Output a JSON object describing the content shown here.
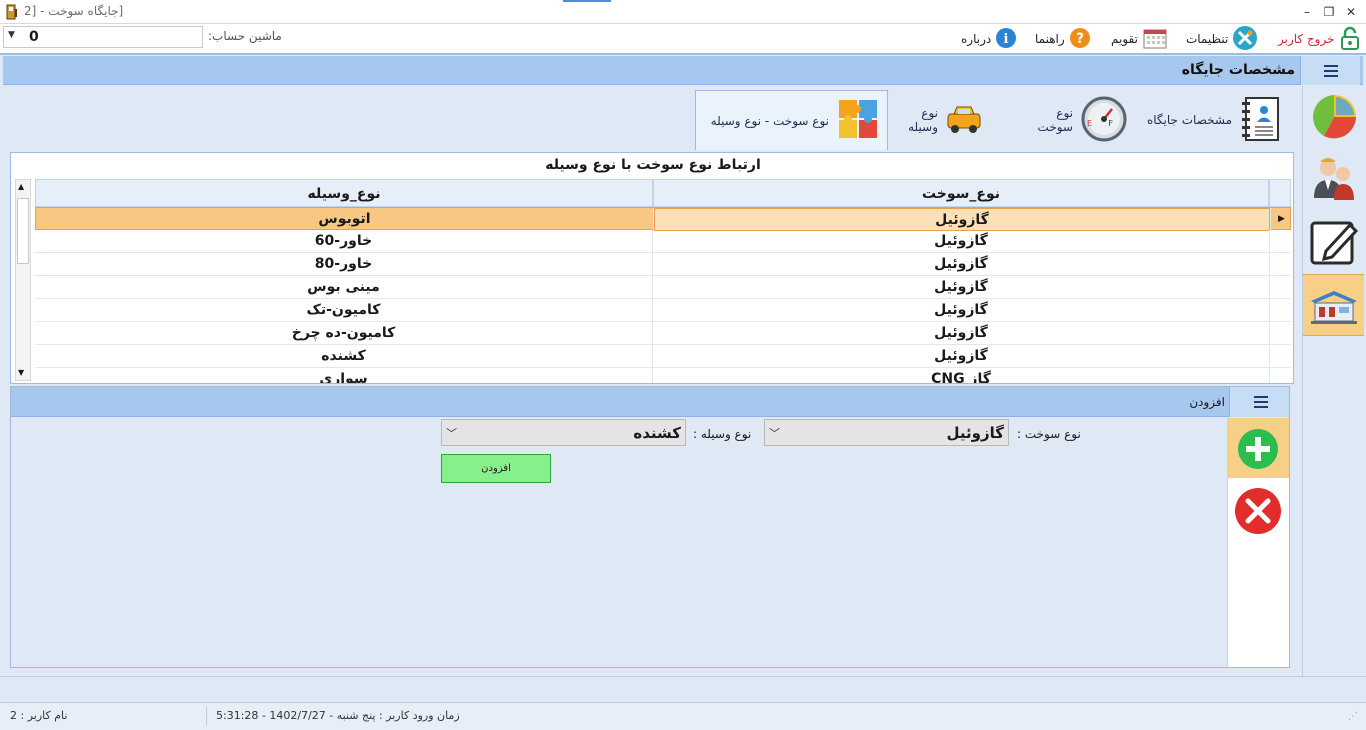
{
  "window": {
    "title": "[جایگاه سوخت - [2",
    "minimize": "–",
    "restore": "❐",
    "close": "✕"
  },
  "toolbar": {
    "account_label": "ماشین حساب:",
    "account_value": "0",
    "items": [
      {
        "label": "خروج کاربر",
        "icon": "lock-open-icon"
      },
      {
        "label": "تنظیمات",
        "icon": "tools-icon"
      },
      {
        "label": "تقویم",
        "icon": "calendar-icon"
      },
      {
        "label": "راهنما",
        "icon": "help-icon"
      },
      {
        "label": "درباره",
        "icon": "info-icon"
      }
    ]
  },
  "header": {
    "title": "مشخصات جایگاه"
  },
  "tabs": [
    {
      "label": "مشخصات جایگاه",
      "icon": "notebook-icon"
    },
    {
      "label": "نوع سوخت",
      "icon": "fuel-gauge-icon"
    },
    {
      "label": "نوع وسیله",
      "icon": "car-icon"
    },
    {
      "label": "نوع سوخت - نوع وسیله",
      "icon": "puzzle-icon",
      "active": true
    }
  ],
  "sidebar": [
    {
      "name": "chart-icon"
    },
    {
      "name": "users-icon"
    },
    {
      "name": "edit-icon"
    },
    {
      "name": "station-icon",
      "active": true
    }
  ],
  "grid": {
    "caption": "ارتباط نوع سوخت با نوع وسیله",
    "columns": [
      "نوع_سوخت",
      "نوع_وسیله"
    ],
    "rows": [
      [
        "گازوئیل",
        "اتوبوس"
      ],
      [
        "گازوئیل",
        "خاور-60"
      ],
      [
        "گازوئیل",
        "خاور-80"
      ],
      [
        "گازوئیل",
        "مینی بوس"
      ],
      [
        "گازوئیل",
        "کامیون-تک"
      ],
      [
        "گازوئیل",
        "کامیون-ده چرخ"
      ],
      [
        "گازوئیل",
        "کشنده"
      ],
      [
        "گاز CNG",
        "سواری"
      ]
    ],
    "selected_row": 0
  },
  "add_panel": {
    "title": "افزودن",
    "fuel_label": "نوع سوخت :",
    "fuel_value": "گازوئیل",
    "vehicle_label": "نوع وسیله :",
    "vehicle_value": "کشنده",
    "submit_label": "افزودن"
  },
  "status": {
    "login_time": "زمان ورود کاربر : پنج شنبه - 1402/7/27 - 5:31:28",
    "user_name": "نام کاربر : 2"
  },
  "colors": {
    "header_blue": "#a6c8ef",
    "selection_orange": "#f8c784",
    "add_green": "#2bbd4e",
    "delete_red": "#e32c2c"
  }
}
